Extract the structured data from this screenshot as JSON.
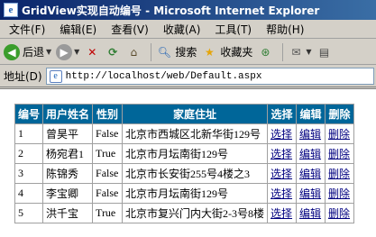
{
  "window": {
    "title": "GridView实现自动编号 - Microsoft Internet Explorer"
  },
  "menu": [
    "文件(F)",
    "编辑(E)",
    "查看(V)",
    "收藏(A)",
    "工具(T)",
    "帮助(H)"
  ],
  "toolbar": {
    "back_label": "后退",
    "search_label": "搜索",
    "favorites_label": "收藏夹"
  },
  "address": {
    "label": "地址(D)",
    "url": "http://localhost/web/Default.aspx"
  },
  "grid": {
    "headers": [
      "编号",
      "用户姓名",
      "性别",
      "家庭住址",
      "选择",
      "编辑",
      "删除"
    ],
    "rows": [
      {
        "id": "1",
        "name": "曾昊平",
        "sex": "False",
        "address": "北京市西城区北新华街129号",
        "select": "选择",
        "edit": "编辑",
        "delete": "删除"
      },
      {
        "id": "2",
        "name": "杨宛君1",
        "sex": "True",
        "address": "北京市月坛南街129号",
        "select": "选择",
        "edit": "编辑",
        "delete": "删除"
      },
      {
        "id": "3",
        "name": "陈锦秀",
        "sex": "False",
        "address": "北京市长安街255号4楼之3",
        "select": "选择",
        "edit": "编辑",
        "delete": "删除"
      },
      {
        "id": "4",
        "name": "李宝卿",
        "sex": "False",
        "address": "北京市月坛南街129号",
        "select": "选择",
        "edit": "编辑",
        "delete": "删除"
      },
      {
        "id": "5",
        "name": "洪千宝",
        "sex": "True",
        "address": "北京市复兴门内大街2-3号8楼",
        "select": "选择",
        "edit": "编辑",
        "delete": "删除"
      }
    ]
  },
  "colors": {
    "header_bg": "#006699",
    "link": "#000080"
  }
}
